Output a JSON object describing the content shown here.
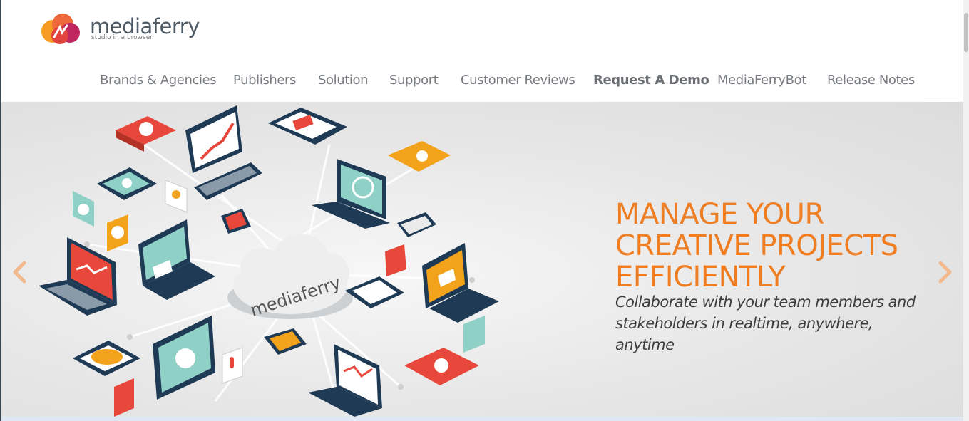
{
  "brand": {
    "name_part1": "media",
    "name_part2": "ferry",
    "tagline": "studio in a browser"
  },
  "nav": {
    "items": [
      {
        "label": "Brands & Agencies"
      },
      {
        "label": "Publishers"
      },
      {
        "label": "Solution"
      },
      {
        "label": "Support"
      },
      {
        "label": "Customer Reviews"
      },
      {
        "label": "Request A Demo"
      },
      {
        "label": "MediaFerryBot"
      },
      {
        "label": "Release Notes"
      }
    ]
  },
  "hero": {
    "title": "MANAGE YOUR\nCREATIVE PROJECTS\nEFFICIENTLY",
    "subtitle": "Collaborate with your team members and stakeholders in realtime, anywhere, anytime",
    "cloud_label": "mediaferry",
    "accent_color": "#ef7d22",
    "prev_icon": "chevron-left-icon",
    "next_icon": "chevron-right-icon"
  }
}
